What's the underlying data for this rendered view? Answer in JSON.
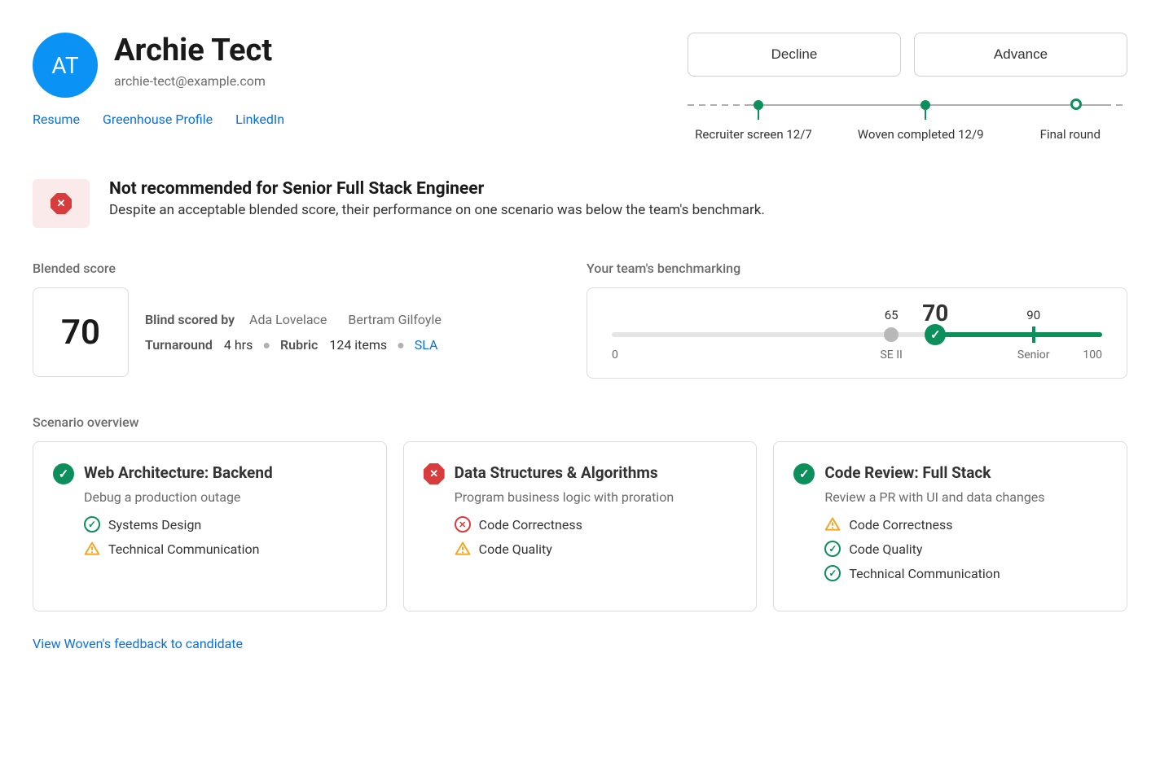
{
  "candidate": {
    "initials": "AT",
    "name": "Archie Tect",
    "email": "archie-tect@example.com",
    "links": {
      "resume": "Resume",
      "greenhouse": "Greenhouse Profile",
      "linkedin": "LinkedIn"
    }
  },
  "actions": {
    "decline": "Decline",
    "advance": "Advance"
  },
  "timeline": {
    "stages": [
      {
        "label": "Recruiter screen 12/7",
        "status": "done",
        "pos": 15
      },
      {
        "label": "Woven completed 12/9",
        "status": "done",
        "pos": 53
      },
      {
        "label": "Final round",
        "status": "pending",
        "pos": 87
      }
    ]
  },
  "recommendation": {
    "title": "Not recommended for Senior Full Stack Engineer",
    "body": "Despite an acceptable blended score, their performance on one scenario was below the team's benchmark."
  },
  "blended": {
    "label": "Blended score",
    "score": "70",
    "scored_by_label": "Blind scored by",
    "scorers": [
      "Ada Lovelace",
      "Bertram Gilfoyle"
    ],
    "turnaround_label": "Turnaround",
    "turnaround_value": "4 hrs",
    "rubric_label": "Rubric",
    "rubric_value": "124 items",
    "sla": "SLA"
  },
  "benchmark": {
    "label": "Your team's benchmarking",
    "min": "0",
    "max": "100",
    "se2": {
      "value": "65",
      "label": "SE II",
      "pos": 57
    },
    "candidate": {
      "value": "70",
      "pos": 66
    },
    "senior": {
      "value": "90",
      "label": "Senior",
      "pos": 86
    }
  },
  "scenarios": {
    "label": "Scenario overview",
    "cards": [
      {
        "status": "pass",
        "title": "Web Architecture: Backend",
        "sub": "Debug a production outage",
        "skills": [
          {
            "status": "pass",
            "name": "Systems Design"
          },
          {
            "status": "warn",
            "name": "Technical Communication"
          }
        ]
      },
      {
        "status": "fail",
        "title": "Data Structures & Algorithms",
        "sub": "Program business logic with proration",
        "skills": [
          {
            "status": "fail",
            "name": "Code Correctness"
          },
          {
            "status": "warn",
            "name": "Code Quality"
          }
        ]
      },
      {
        "status": "pass",
        "title": "Code Review: Full Stack",
        "sub": "Review a PR with UI and data changes",
        "skills": [
          {
            "status": "warn",
            "name": "Code Correctness"
          },
          {
            "status": "pass",
            "name": "Code Quality"
          },
          {
            "status": "pass",
            "name": "Technical Communication"
          }
        ]
      }
    ]
  },
  "footer": {
    "feedback_link": "View Woven's feedback to candidate"
  }
}
